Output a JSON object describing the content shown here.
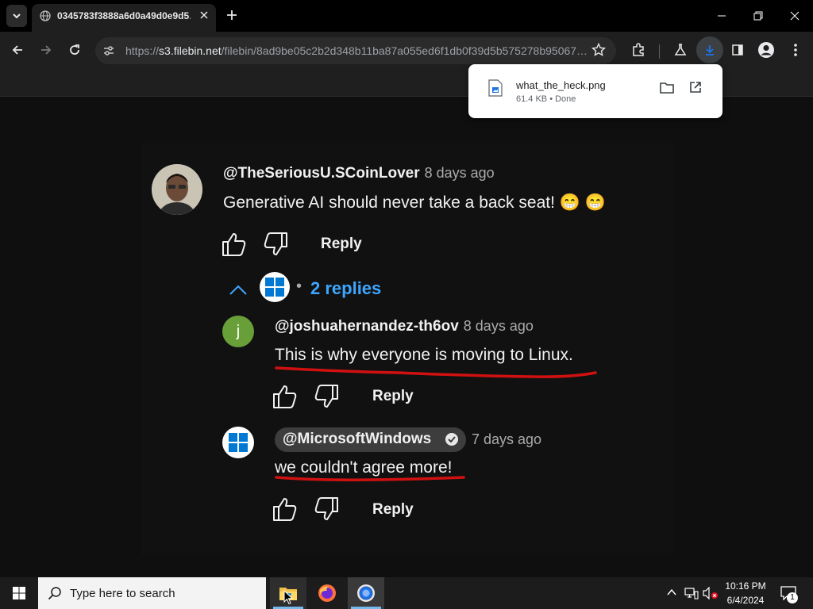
{
  "browser": {
    "tab_title": "0345783f3888a6d0a49d0e9d5…",
    "url_host": "s3.filebin.net",
    "url_prefix": "https://",
    "url_path": "/filebin/8ad9be05c2b2d348b11ba87a055ed6f1db0f39d5b575278b95067…",
    "icons": [
      "tab-search-icon",
      "globe-icon",
      "close-icon",
      "plus-icon",
      "minimize-icon",
      "restore-icon",
      "back-arrow-icon",
      "forward-arrow-icon",
      "reload-icon",
      "site-info-icon",
      "star-icon",
      "extensions-icon",
      "labs-flask-icon",
      "download-icon",
      "side-panel-icon",
      "profile-icon",
      "more-vert-icon"
    ]
  },
  "download": {
    "filename": "what_the_heck.png",
    "status": "61.4 KB • Done"
  },
  "comments": {
    "main": {
      "username": "@TheSeriousU.SCoinLover",
      "time": "8 days ago",
      "text": "Generative AI should never take a back seat! 😁 😁",
      "reply_label": "Reply"
    },
    "replies_toggle": {
      "bullet": "•",
      "label": "2 replies"
    },
    "reply1": {
      "avatar_letter": "j",
      "username": "@joshuahernandez-th6ov",
      "time": "8 days ago",
      "text": "This is why everyone is moving to Linux.",
      "reply_label": "Reply"
    },
    "reply2": {
      "username": "@MicrosoftWindows",
      "time": "7 days ago",
      "text": "we couldn't agree more!",
      "reply_label": "Reply"
    }
  },
  "taskbar": {
    "search_placeholder": "Type here to search",
    "time": "10:16 PM",
    "date": "6/4/2024",
    "notification_count": "1"
  },
  "colors": {
    "link_blue": "#3ea6ff",
    "annotation_red": "#d11111",
    "avatar_green": "#689f38",
    "windows_blue": "#0078d4"
  }
}
